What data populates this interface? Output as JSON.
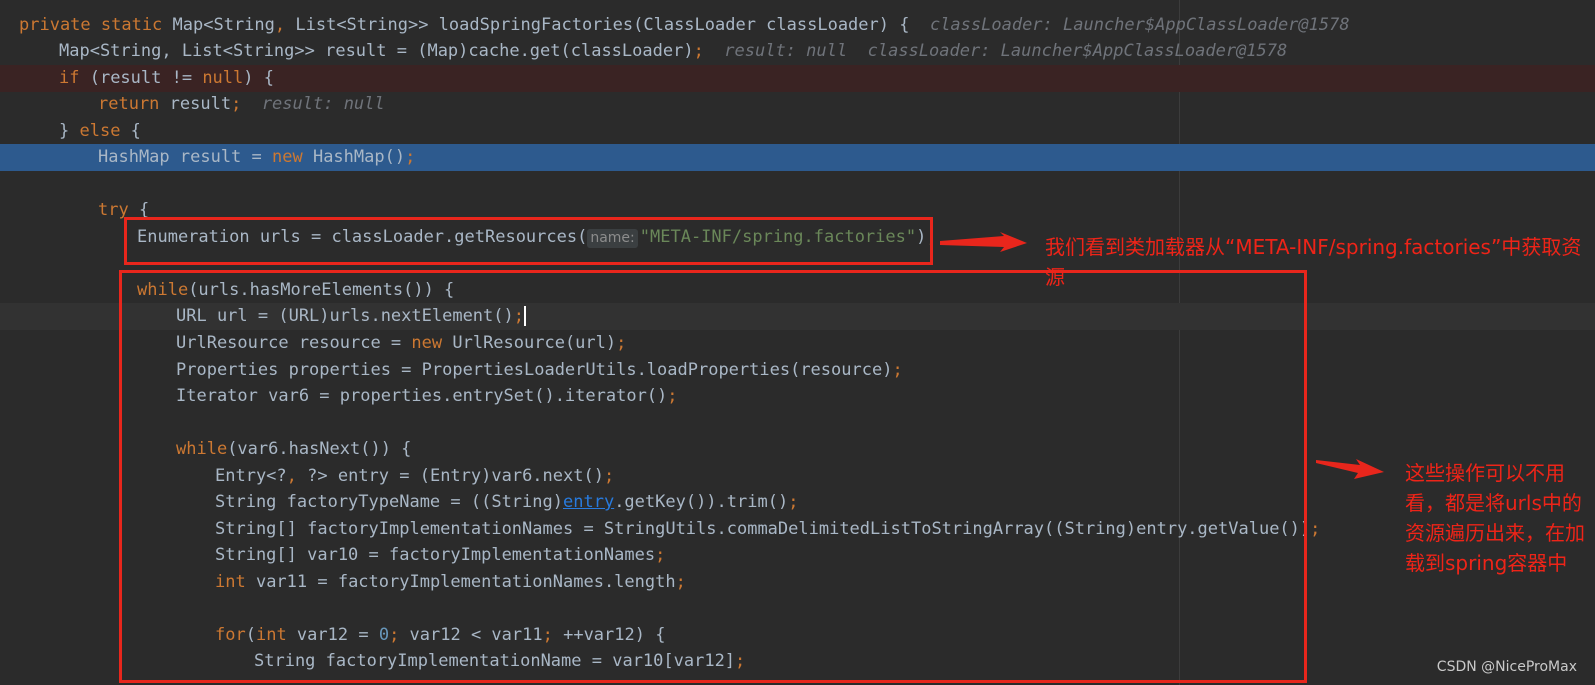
{
  "code": {
    "l1": {
      "a": "private static ",
      "b": "Map<String",
      "c": ", ",
      "d": "List<String>> loadSpringFactories(ClassLoader classLoader) {",
      "hint": "classLoader: Launcher$AppClassLoader@1578"
    },
    "l2": {
      "a": "Map<String, List<String>> result = (Map)cache.get(classLoader)",
      "semi": ";",
      "hint1": "result: null",
      "hint2": "classLoader: Launcher$AppClassLoader@1578"
    },
    "l3": {
      "kw": "if",
      "a": " (result != ",
      "null": "null",
      "b": ") {"
    },
    "l4": {
      "kw": "return",
      "a": " result",
      "semi": ";",
      "hint": "result: null"
    },
    "l5": {
      "a": "} ",
      "kw": "else",
      "b": " {"
    },
    "l6": {
      "a": "HashMap result = ",
      "kw": "new",
      "b": " HashMap()",
      "semi": ";"
    },
    "l8": {
      "kw": "try",
      "a": " {"
    },
    "l9": {
      "a": "Enumeration urls = classLoader.getResources(",
      "param": "name:",
      "str": "\"META-INF/spring.factories\"",
      "b": ")",
      "semi": ";"
    },
    "l11": {
      "kw": "while",
      "a": "(urls.hasMoreElements()) {"
    },
    "l12": {
      "a": "URL url = (URL)urls.nextElement()",
      "semi": ";"
    },
    "l13": {
      "a": "UrlResource resource = ",
      "kw": "new",
      "b": " UrlResource(url)",
      "semi": ";"
    },
    "l14": {
      "a": "Properties properties = PropertiesLoaderUtils.loadProperties(resource)",
      "semi": ";"
    },
    "l15": {
      "a": "Iterator var6 = properties.entrySet().iterator()",
      "semi": ";"
    },
    "l17": {
      "kw": "while",
      "a": "(var6.hasNext()) {"
    },
    "l18": {
      "a": "Entry<?",
      "c": ", ",
      "b": "?> entry = (Entry)var6.next()",
      "semi": ";"
    },
    "l19": {
      "a": "String factoryTypeName = ((String)",
      "link": "entry",
      "b": ".getKey()).trim()",
      "semi": ";"
    },
    "l20": {
      "a": "String[] factoryImplementationNames = StringUtils.commaDelimitedListToStringArray((String)entry.getValue())",
      "semi": ";"
    },
    "l21": {
      "a": "String[] var10 = factoryImplementationNames",
      "semi": ";"
    },
    "l22": {
      "kw": "int",
      "a": " var11 = factoryImplementationNames.length",
      "semi": ";"
    },
    "l24": {
      "kw": "for",
      "a": "(",
      "kw2": "int",
      "b": " var12 = ",
      "num": "0",
      "semi1": ";",
      "c": " var12 < var11",
      "semi2": ";",
      "d": " ++var12) {"
    },
    "l25": {
      "a": "String factoryImplementationName = var10[var12]",
      "semi": ";"
    }
  },
  "annotations": {
    "top": "我们看到类加载器从“META-INF/spring.factories”中获取资源",
    "right": "这些操作可以不用看，都是将urls中的资源遍历出来，在加载到spring容器中"
  },
  "watermark": "CSDN @NiceProMax",
  "colors": {
    "background": "#2b2b2b",
    "keyword": "#cc7832",
    "string": "#6a8759",
    "selection": "#2d5a8e",
    "annotation": "#ee2418"
  }
}
